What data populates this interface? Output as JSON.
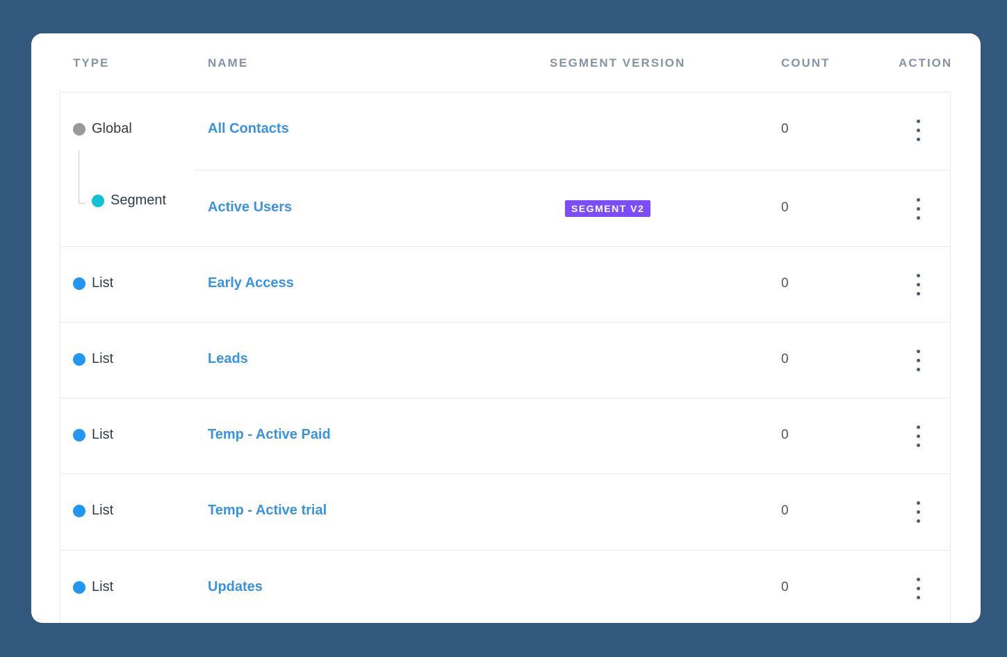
{
  "table": {
    "headers": {
      "type": "TYPE",
      "name": "NAME",
      "segment_version": "SEGMENT VERSION",
      "count": "COUNT",
      "action": "ACTION"
    },
    "rows": [
      {
        "type": "Global",
        "type_color": "#9a9a9a",
        "name": "All Contacts",
        "version": "",
        "count": "0"
      },
      {
        "type": "Segment",
        "type_color": "#12c1d4",
        "name": "Active Users",
        "version": "SEGMENT V2",
        "count": "0"
      },
      {
        "type": "List",
        "type_color": "#2196f3",
        "name": "Early Access",
        "version": "",
        "count": "0"
      },
      {
        "type": "List",
        "type_color": "#2196f3",
        "name": "Leads",
        "version": "",
        "count": "0"
      },
      {
        "type": "List",
        "type_color": "#2196f3",
        "name": "Temp - Active Paid",
        "version": "",
        "count": "0"
      },
      {
        "type": "List",
        "type_color": "#2196f3",
        "name": "Temp - Active trial",
        "version": "",
        "count": "0"
      },
      {
        "type": "List",
        "type_color": "#2196f3",
        "name": "Updates",
        "version": "",
        "count": "0"
      }
    ]
  },
  "icons": {
    "action": "kebab-menu-icon",
    "type_marker": "status-dot-icon"
  },
  "colors": {
    "background": "#31587d",
    "link": "#3a93e2",
    "badge": "#7c4dff"
  }
}
